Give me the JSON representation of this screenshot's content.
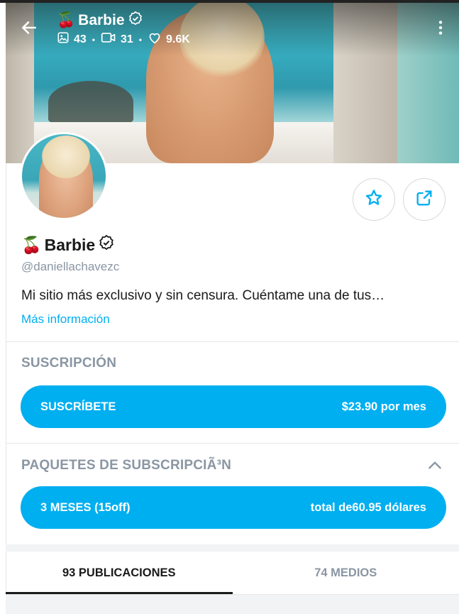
{
  "header": {
    "emoji": "🍒",
    "name": "Barbie",
    "stats": {
      "photos": "43",
      "videos": "31",
      "likes": "9.6K"
    }
  },
  "profile": {
    "emoji": "🍒",
    "name": "Barbie",
    "handle": "@daniellachavezc",
    "bio": "Mi sitio más exclusivo y sin censura. Cuéntame una de tus…",
    "more_info": "Más información"
  },
  "subscription": {
    "title": "SUSCRIPCIÓN",
    "button_label": "SUSCRÍBETE",
    "button_price": "$23.90 por mes"
  },
  "bundles": {
    "title": "PAQUETES DE SUBSCRIPCIÃ³N",
    "button_label": "3 MESES (15off)",
    "button_price": "total de60.95 dólares"
  },
  "tabs": [
    {
      "label": "93 PUBLICACIONES",
      "active": true
    },
    {
      "label": "74 MEDIOS",
      "active": false
    }
  ],
  "icons": [
    "back-arrow-icon",
    "verified-icon",
    "image-icon",
    "video-icon",
    "heart-icon",
    "more-vertical-icon",
    "star-icon",
    "share-icon",
    "chevron-up-icon"
  ],
  "colors": {
    "accent": "#00aff0",
    "muted": "#8a96a3",
    "text": "#1a1a1a"
  }
}
